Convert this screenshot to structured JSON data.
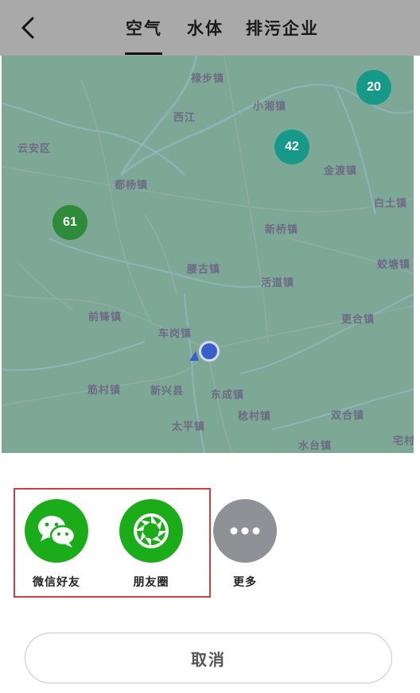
{
  "header": {
    "back_icon": "chevron-left-icon",
    "tabs": [
      {
        "label": "空气",
        "active": true
      },
      {
        "label": "水体",
        "active": false
      },
      {
        "label": "排污企业",
        "active": false
      }
    ]
  },
  "map": {
    "places": [
      "禄步镇",
      "西江",
      "小湘镇",
      "云安区",
      "金渡镇",
      "都杨镇",
      "白土镇",
      "新桥镇",
      "腰古镇",
      "蛟塘镇",
      "活道镇",
      "前锋镇",
      "更合镇",
      "车岗镇",
      "筋村镇",
      "新兴县",
      "东成镇",
      "稔村镇",
      "双合镇",
      "太平镇",
      "水台镇",
      "宅村"
    ],
    "clusters": [
      {
        "value": "20",
        "color": "#17998a"
      },
      {
        "value": "42",
        "color": "#17998a"
      },
      {
        "value": "61",
        "color": "#2e8b3a"
      }
    ],
    "location_icon": "current-location-icon"
  },
  "share_sheet": {
    "items": [
      {
        "label": "微信好友",
        "icon": "wechat-icon",
        "color": "#1aad19"
      },
      {
        "label": "朋友圈",
        "icon": "moments-icon",
        "color": "#1aad19"
      },
      {
        "label": "更多",
        "icon": "more-icon",
        "color": "#8e9296"
      }
    ],
    "cancel_label": "取消"
  }
}
